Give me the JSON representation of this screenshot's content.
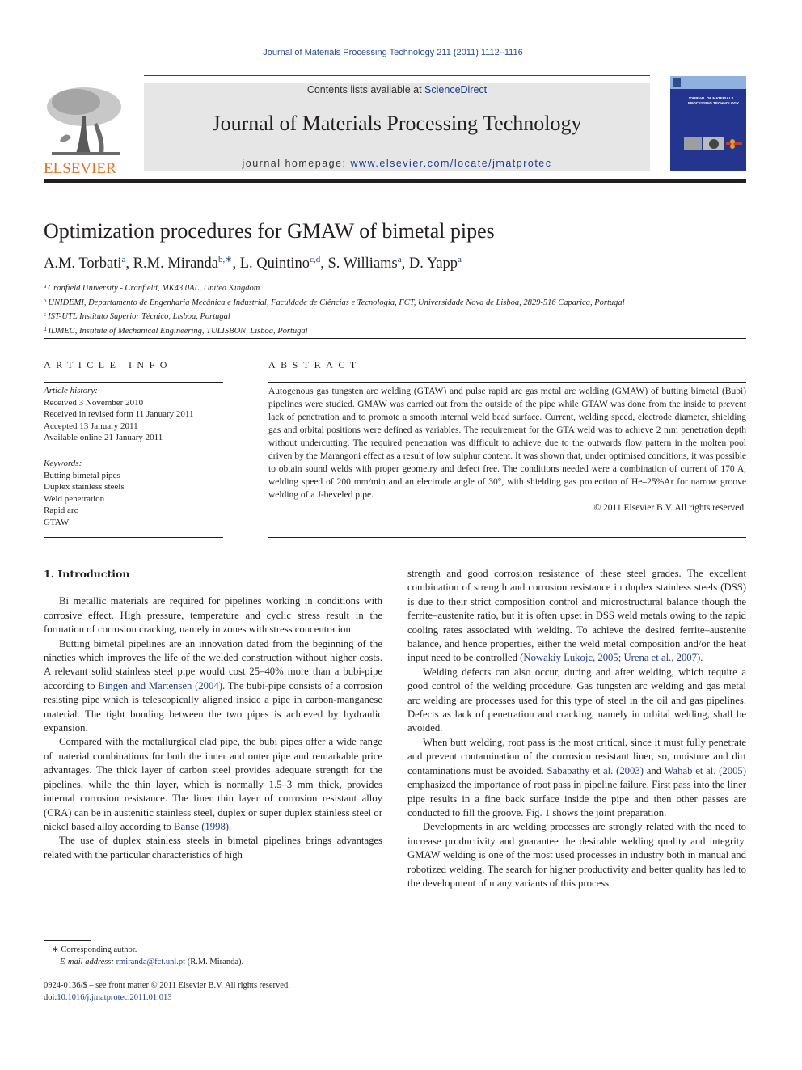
{
  "header": {
    "citation": "Journal of Materials Processing Technology 211 (2011) 1112–1116",
    "publisher_logo_text": "ELSEVIER",
    "contents_prefix": "Contents lists available at ",
    "contents_link": "ScienceDirect",
    "journal_title": "Journal of Materials Processing Technology",
    "homepage_prefix": "journal homepage: ",
    "homepage_link": "www.elsevier.com/locate/jmatprotec",
    "cover_title": "JOURNAL OF MATERIALS PROCESSING TECHNOLOGY"
  },
  "article": {
    "title": "Optimization procedures for GMAW of bimetal pipes",
    "authors": [
      {
        "name": "A.M. Torbati",
        "sup": "a",
        "sep": ", "
      },
      {
        "name": "R.M. Miranda",
        "sup": "b,∗",
        "sep": ", "
      },
      {
        "name": "L. Quintino",
        "sup": "c,d",
        "sep": ", "
      },
      {
        "name": "S. Williams",
        "sup": "a",
        "sep": ", "
      },
      {
        "name": "D. Yapp",
        "sup": "a",
        "sep": ""
      }
    ],
    "affiliations": [
      {
        "key": "a",
        "text": "Cranfield University - Cranfield, MK43 0AL, United Kingdom"
      },
      {
        "key": "b",
        "text": "UNIDEMI, Departamento de Engenharia Mecânica e Industrial, Faculdade de Ciências e Tecnologia, FCT, Universidade Nova de Lisboa, 2829-516 Caparica, Portugal"
      },
      {
        "key": "c",
        "text": "IST-UTL Instituto Superior Técnico, Lisboa, Portugal"
      },
      {
        "key": "d",
        "text": "IDMEC, Institute of Mechanical Engineering, TULISBON, Lisboa, Portugal"
      }
    ]
  },
  "article_info": {
    "heading": "ARTICLE INFO",
    "history_label": "Article history:",
    "history": [
      "Received 3 November 2010",
      "Received in revised form 11 January 2011",
      "Accepted 13 January 2011",
      "Available online 21 January 2011"
    ],
    "keywords_label": "Keywords:",
    "keywords": [
      "Butting bimetal pipes",
      "Duplex stainless steels",
      "Weld penetration",
      "Rapid arc",
      "GTAW"
    ]
  },
  "abstract": {
    "heading": "ABSTRACT",
    "text": "Autogenous gas tungsten arc welding (GTAW) and pulse rapid arc gas metal arc welding (GMAW) of butting bimetal (Bubi) pipelines were studied. GMAW was carried out from the outside of the pipe while GTAW was done from the inside to prevent lack of penetration and to promote a smooth internal weld bead surface. Current, welding speed, electrode diameter, shielding gas and orbital positions were defined as variables. The requirement for the GTA weld was to achieve 2 mm penetration depth without undercutting. The required penetration was difficult to achieve due to the outwards flow pattern in the molten pool driven by the Marangoni effect as a result of low sulphur content. It was shown that, under optimised conditions, it was possible to obtain sound welds with proper geometry and defect free. The conditions needed were a combination of current of 170 A, welding speed of 200 mm/min and an electrode angle of 30°, with shielding gas protection of He–25%Ar for narrow groove welding of a J-beveled pipe.",
    "copyright": "© 2011 Elsevier B.V. All rights reserved."
  },
  "body": {
    "section_heading": "1.  Introduction",
    "left": {
      "p1": "Bi metallic materials are required for pipelines working in conditions with corrosive effect. High pressure, temperature and cyclic stress result in the formation of corrosion cracking, namely in zones with stress concentration.",
      "p2_a": "Butting bimetal pipelines are an innovation dated from the beginning of the nineties which improves the life of the welded construction without higher costs. A relevant solid stainless steel pipe would cost 25–40% more than a bubi-pipe according to ",
      "p2_link": "Bingen and Martensen (2004)",
      "p2_b": ". The bubi-pipe consists of a corrosion resisting pipe which is telescopically aligned inside a pipe in carbon-manganese material. The tight bonding between the two pipes is achieved by hydraulic expansion.",
      "p3_a": "Compared with the metallurgical clad pipe, the bubi pipes offer a wide range of material combinations for both the inner and outer pipe and remarkable price advantages. The thick layer of carbon steel provides adequate strength for the pipelines, while the thin layer, which is normally 1.5–3 mm thick, provides internal corrosion resistance. The liner thin layer of corrosion resistant alloy (CRA) can be in austenitic stainless steel, duplex or super duplex stainless steel or nickel based alloy according to ",
      "p3_link": "Banse (1998)",
      "p3_b": ".",
      "p4": "The use of duplex stainless steels in bimetal pipelines brings advantages related with the particular characteristics of high"
    },
    "right": {
      "p1_a": "strength and good corrosion resistance of these steel grades. The excellent combination of strength and corrosion resistance in duplex stainless steels (DSS) is due to their strict composition control and microstructural balance though the ferrite–austenite ratio, but it is often upset in DSS weld metals owing to the rapid cooling rates associated with welding. To achieve the desired ferrite–austenite balance, and hence properties, either the weld metal composition and/or the heat input need to be controlled (",
      "p1_link": "Nowakiy Lukojc, 2005; Urena et al., 2007",
      "p1_b": ").",
      "p2": "Welding defects can also occur, during and after welding, which require a good control of the welding procedure. Gas tungsten arc welding and gas metal arc welding are processes used for this type of steel in the oil and gas pipelines. Defects as lack of penetration and cracking, namely in orbital welding, shall be avoided.",
      "p3_a": "When butt welding, root pass is the most critical, since it must fully penetrate and prevent contamination of the corrosion resistant liner, so, moisture and dirt contaminations must be avoided. ",
      "p3_link1": "Sabapathy et al. (2003)",
      "p3_mid": " and ",
      "p3_link2": "Wahab et al. (2005)",
      "p3_b": " emphasized the importance of root pass in pipeline failure. First pass into the liner pipe results in a fine back surface inside the pipe and then other passes are conducted to fill the groove. ",
      "p3_link3": "Fig. 1",
      "p3_c": " shows the joint preparation.",
      "p4": "Developments in arc welding processes are strongly related with the need to increase productivity and guarantee the desirable welding quality and integrity. GMAW welding is one of the most used processes in industry both in manual and robotized welding. The search for higher productivity and better quality has led to the development of many variants of this process."
    }
  },
  "footnote": {
    "corresponding": "∗  Corresponding author.",
    "email_label": "E-mail address: ",
    "email": "rmiranda@fct.unl.pt",
    "email_suffix": " (R.M. Miranda)."
  },
  "front_matter": {
    "issn_line": "0924-0136/$ – see front matter © 2011 Elsevier B.V. All rights reserved.",
    "doi_prefix": "doi:",
    "doi": "10.1016/j.jmatprotec.2011.01.013"
  }
}
